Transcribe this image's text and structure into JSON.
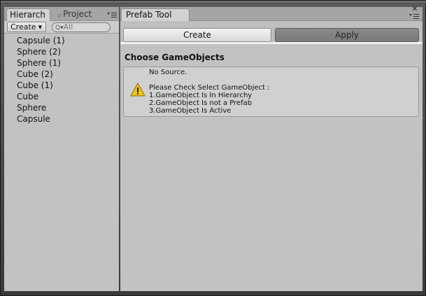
{
  "hierarchy_panel": {
    "tab_hierarchy": "Hierarch",
    "tab_project": "Project",
    "create_label": "Create",
    "search_placeholder": "All",
    "items": [
      {
        "label": "Capsule (1)"
      },
      {
        "label": "Sphere (2)"
      },
      {
        "label": "Sphere (1)"
      },
      {
        "label": "Cube (2)"
      },
      {
        "label": "Cube (1)"
      },
      {
        "label": "Cube"
      },
      {
        "label": "Sphere"
      },
      {
        "label": "Capsule"
      }
    ]
  },
  "prefab_tool": {
    "tab_title": "Prefab Tool",
    "create_button": "Create",
    "apply_button": "Apply",
    "section_title": "Choose GameObjects",
    "help": {
      "line1": "No Source.",
      "line2": "Please Check Select GameObject :",
      "line3": "1.GameObject Is In Hierarchy",
      "line4": "2.GameObject Is not a Prefab",
      "line5": "3.GameObject Is Active"
    }
  },
  "colors": {
    "panel_bg": "#c2c2c2",
    "tab_bar_bg": "#a5a5a5",
    "apply_button_bg": "#7f7f7f",
    "warning_icon": "#f0c419"
  },
  "icons": {
    "panel_menu": "panel-menu-icon",
    "close": "close-icon",
    "warning": "warning-icon",
    "search": "search-icon",
    "folder": "folder-icon"
  }
}
